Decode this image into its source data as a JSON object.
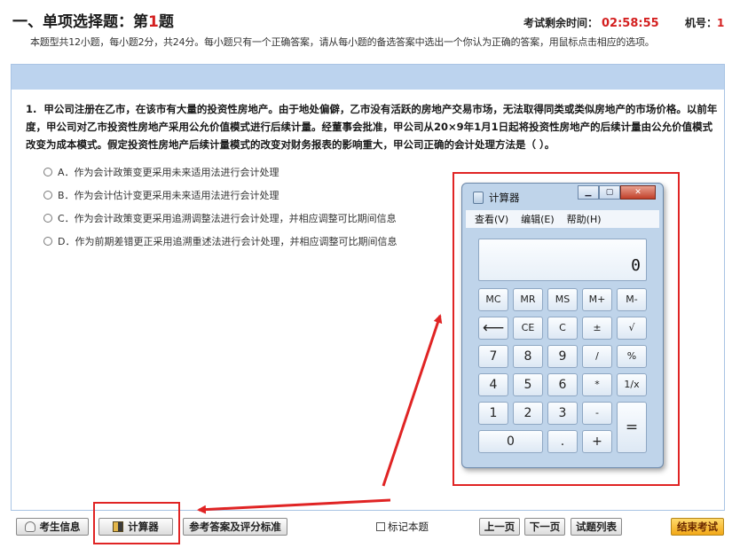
{
  "section": {
    "title_prefix": "一、单项选择题：第",
    "question_number": "1",
    "title_suffix": "题"
  },
  "description": "本题型共12小题，每小题2分，共24分。每小题只有一个正确答案，请从每小题的备选答案中选出一个你认为正确的答案，用鼠标点击相应的选项。",
  "timer": {
    "label": "考试剩余时间：",
    "value": "02:58:55"
  },
  "machine": {
    "label": "机号：",
    "value": "1"
  },
  "question": {
    "number": "1.",
    "text": "甲公司注册在乙市，在该市有大量的投资性房地产。由于地处偏僻，乙市没有活跃的房地产交易市场，无法取得同类或类似房地产的市场价格。以前年度，甲公司对乙市投资性房地产采用公允价值模式进行后续计量。经董事会批准，甲公司从20×9年1月1日起将投资性房地产的后续计量由公允价值模式改变为成本模式。假定投资性房地产后续计量模式的改变对财务报表的影响重大，甲公司正确的会计处理方法是（ ）。"
  },
  "options": [
    "A．作为会计政策变更采用未来适用法进行会计处理",
    "B．作为会计估计变更采用未来适用法进行会计处理",
    "C．作为会计政策变更采用追溯调整法进行会计处理，并相应调整可比期间信息",
    "D．作为前期差错更正采用追溯重述法进行会计处理，并相应调整可比期间信息"
  ],
  "calculator": {
    "title": "计算器",
    "menu": [
      "查看(V)",
      "编辑(E)",
      "帮助(H)"
    ],
    "display": "0",
    "keys": {
      "mc": "MC",
      "mr": "MR",
      "ms": "MS",
      "mplus": "M+",
      "mminus": "M-",
      "back": "⟵",
      "ce": "CE",
      "c": "C",
      "pm": "±",
      "sqrt": "√",
      "k7": "7",
      "k8": "8",
      "k9": "9",
      "div": "/",
      "pct": "%",
      "k4": "4",
      "k5": "5",
      "k6": "6",
      "mul": "*",
      "recip": "1/x",
      "k1": "1",
      "k2": "2",
      "k3": "3",
      "minus": "-",
      "eq": "=",
      "k0": "0",
      "dot": ".",
      "plus": "+"
    }
  },
  "toolbar": {
    "candidate_info": "考生信息",
    "calculator": "计算器",
    "reference": "参考答案及评分标准",
    "mark": "标记本题",
    "prev": "上一页",
    "next": "下一页",
    "list": "试题列表",
    "end": "结束考试"
  },
  "colors": {
    "accent_red": "#d42020",
    "annotation_red": "#e02424",
    "blue_bar": "#bcd3ee",
    "end_button": "#f2a818"
  }
}
